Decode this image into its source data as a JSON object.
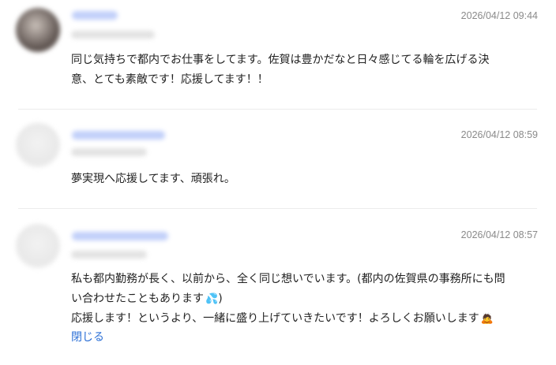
{
  "comments": [
    {
      "timestamp": "2026/04/12 09:44",
      "text": "同じ気持ちで都内でお仕事をしてます。佐賀は豊かだなと日々感じてる輪を広げる決\n意、とても素敵です！応援してます！！"
    },
    {
      "timestamp": "2026/04/12 08:59",
      "text": "夢実現へ応援してます、頑張れ。"
    },
    {
      "timestamp": "2026/04/12 08:57",
      "text_line1": "私も都内勤務が長く、以前から、全く同じ想いでいます。(都内の佐賀県の事務所にも問\nい合わせたこともあります",
      "emoji1": "💦",
      "text_line2": ")\n応援します！というより、一緒に盛り上げていきたいです！よろしくお願いします",
      "emoji2": "🙇",
      "close_label": "閉じる"
    }
  ]
}
